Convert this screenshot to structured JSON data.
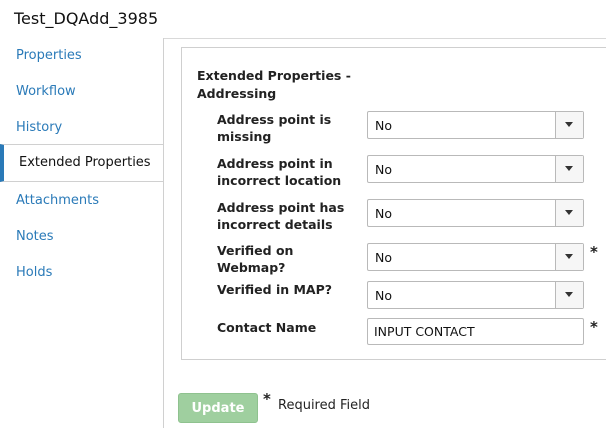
{
  "window": {
    "title": "Test_DQAdd_3985"
  },
  "sidebar": {
    "items": [
      {
        "label": "Properties"
      },
      {
        "label": "Workflow"
      },
      {
        "label": "History"
      },
      {
        "label": "Extended Properties"
      },
      {
        "label": "Attachments"
      },
      {
        "label": "Notes"
      },
      {
        "label": "Holds"
      }
    ],
    "active_index": 3
  },
  "section": {
    "title": "Extended Properties - Addressing"
  },
  "fields": [
    {
      "label": "Address point is missing",
      "value": "No",
      "type": "select",
      "required": false
    },
    {
      "label": "Address point in incorrect location",
      "value": "No",
      "type": "select",
      "required": false
    },
    {
      "label": "Address point has incorrect details",
      "value": "No",
      "type": "select",
      "required": false
    },
    {
      "label": "Verified on Webmap?",
      "value": "No",
      "type": "select",
      "required": true
    },
    {
      "label": "Verified in MAP?",
      "value": "No",
      "type": "select",
      "required": false
    },
    {
      "label": "Contact Name",
      "value": "INPUT CONTACT",
      "type": "text",
      "required": true
    }
  ],
  "footer": {
    "update_label": "Update",
    "required_marker": "*",
    "required_text": "Required Field"
  },
  "colors": {
    "link": "#2a7ab8",
    "update_button": "#9fcf9f"
  }
}
